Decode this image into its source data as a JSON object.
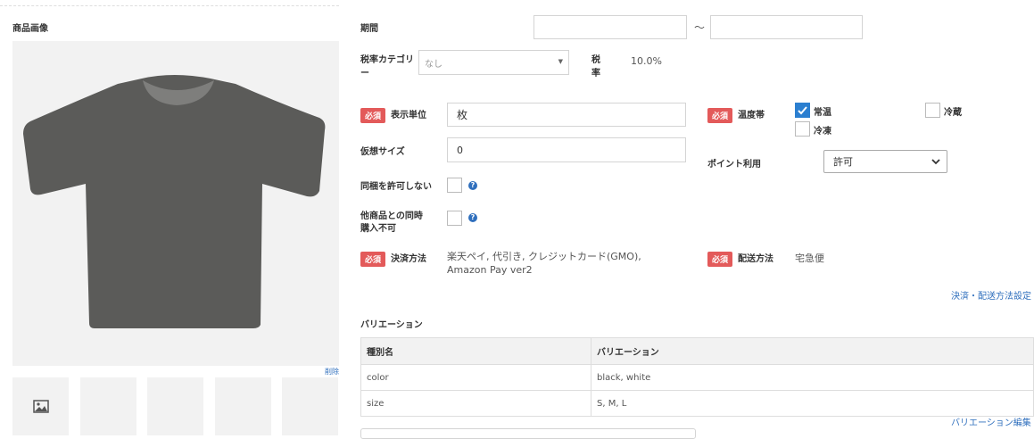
{
  "left": {
    "title": "商品画像",
    "delete_label": "削除"
  },
  "period": {
    "label": "期間",
    "separator": "～"
  },
  "tax": {
    "category_label": "税率カテゴリー",
    "category_value": "なし",
    "rate_label": "税率",
    "rate_value": "10.0%"
  },
  "required_badge": "必須",
  "unit": {
    "label": "表示単位",
    "value": "枚"
  },
  "temperature": {
    "label": "温度帯",
    "options": [
      {
        "label": "常温",
        "checked": true
      },
      {
        "label": "冷蔵",
        "checked": false
      },
      {
        "label": "冷凍",
        "checked": false
      }
    ]
  },
  "virtual_size": {
    "label": "仮想サイズ",
    "value": "0"
  },
  "points": {
    "label": "ポイント利用",
    "value": "許可"
  },
  "bundle": {
    "label": "同梱を許可しない"
  },
  "simultaneous": {
    "label": "他商品との同時購入不可"
  },
  "payment": {
    "label": "決済方法",
    "value": "楽天ペイ, 代引き, クレジットカード(GMO), Amazon Pay ver2"
  },
  "shipping": {
    "label": "配送方法",
    "value": "宅急便"
  },
  "payment_shipping_link": "決済・配送方法設定",
  "variations": {
    "title": "バリエーション",
    "columns": [
      "種別名",
      "バリエーション"
    ],
    "rows": [
      [
        "color",
        "black, white"
      ],
      [
        "size",
        "S, M, L"
      ]
    ],
    "edit_link": "バリエーション編集"
  },
  "colors": {
    "required": "#e35a5a",
    "link": "#2f6fbd",
    "checkbox": "#2b7fd0",
    "tshirt": "#5b5b59"
  }
}
